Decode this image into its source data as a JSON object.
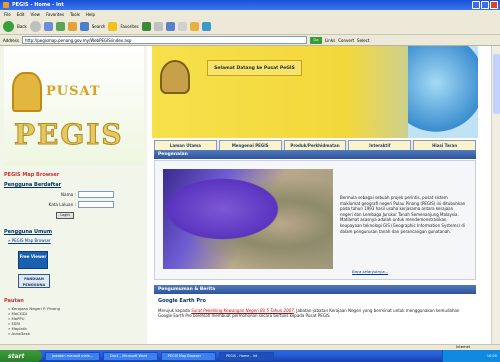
{
  "window": {
    "title": "PEGIS - Home - Int",
    "controls": [
      "minimize",
      "maximize",
      "close"
    ]
  },
  "menu": [
    "File",
    "Edit",
    "View",
    "Favorites",
    "Tools",
    "Help"
  ],
  "toolbar": {
    "back_label": "Back",
    "search_label": "Search",
    "favorites_label": "Favorites"
  },
  "address": {
    "label": "Address",
    "url": "http://pegismap.penang.gov.my/WebPEGIS/index.asp",
    "go_label": "Go",
    "links_label": "Links",
    "convert_label": "Convert",
    "select_label": "Select"
  },
  "banner": {
    "welcome": "Selamat Datang ke Pusat PeGIS"
  },
  "logo": {
    "top": "PUSAT",
    "bottom": "PEGIS"
  },
  "nav": [
    "Laman Utama",
    "Mengenai PEGIS",
    "Produk/Perkhidmatan",
    "Interaktif",
    "Hiasi Taran"
  ],
  "sidebar": {
    "map_browser_title": "PEGIS Map Browser",
    "register_title": "Pengguna Berdaftar",
    "name_label": "Nama :",
    "password_label": "Kata Laluan :",
    "login_label": "Login",
    "public_title": "Pengguna Umum",
    "public_link": "» PEGIS Map Browser",
    "free_viewer": "Free Viewer",
    "guide_label": "PANDUAN PENGGUNA",
    "pautan_title": "Pautan",
    "links": [
      "» Kerajaan Negeri P. Pinang",
      "» MaCGDI",
      "» MaPPU",
      "» ESRI",
      "» MapInfo",
      "» AutoDesk"
    ]
  },
  "pengenalan": {
    "heading": "Pengenalan",
    "text": "Bermula sebagai sebuah projek perintis, pusat sistem maklumat geografi negeri Pulau Pinang (PEGIS) ini ditubuhkan pada tahun 1993 hasil usaha kerjasama antara kerajaan negeri dan Lembaga Jurukur Tanah Semenanjung Malaysia. Matlamat asasnya adalah untuk mendemonstrasikan keupayaan teknologi GIS (Geographic Information Systems) di dalam pengurusan tanah dan perancangan gunatanah.",
    "more": "Baca selanjutnya..."
  },
  "news": {
    "heading": "Pengumuman & Berita",
    "title": "Google Earth Pro",
    "text_before": "Merujuk kepada ",
    "link": "Surat Pekeliling Kewangan Negeri Bil 5 Tahun 2007",
    "text_after": ", Jabatan-jabatan Kerajaan Negeri yang berminat untuk menggunakan kemudahan Google Earth Pro bolehlah membuat permohonan secara bertulis kepada Pusat PEGIS."
  },
  "status": {
    "zone": "Internet"
  },
  "taskbar": {
    "start": "start",
    "items": [
      "Jawatan misrosit mata...",
      "Doc1 - Microsoft Word",
      "PEGIS Map Browser",
      "PEGIS - Home - Int"
    ],
    "clock": "10:00"
  }
}
